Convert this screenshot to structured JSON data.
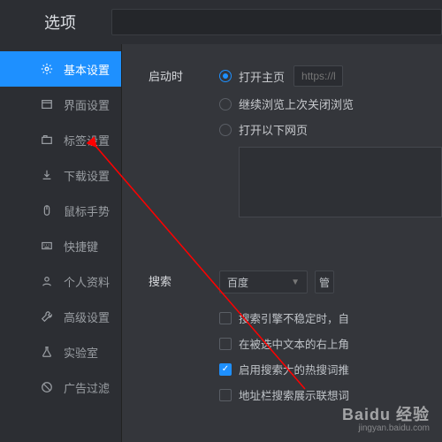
{
  "header": {
    "title": "选项"
  },
  "sidebar": {
    "items": [
      {
        "label": "基本设置",
        "active": true,
        "icon": "gear"
      },
      {
        "label": "界面设置",
        "active": false,
        "icon": "window"
      },
      {
        "label": "标签设置",
        "active": false,
        "icon": "tabs"
      },
      {
        "label": "下载设置",
        "active": false,
        "icon": "download"
      },
      {
        "label": "鼠标手势",
        "active": false,
        "icon": "mouse"
      },
      {
        "label": "快捷键",
        "active": false,
        "icon": "keyboard"
      },
      {
        "label": "个人资料",
        "active": false,
        "icon": "profile"
      },
      {
        "label": "高级设置",
        "active": false,
        "icon": "wrench"
      },
      {
        "label": "实验室",
        "active": false,
        "icon": "flask"
      },
      {
        "label": "广告过滤",
        "active": false,
        "icon": "block"
      }
    ]
  },
  "startup": {
    "label": "启动时",
    "opts": [
      {
        "text": "打开主页",
        "checked": true
      },
      {
        "text": "继续浏览上次关闭浏览",
        "checked": false
      },
      {
        "text": "打开以下网页",
        "checked": false
      }
    ],
    "homepage_placeholder": "https://h"
  },
  "search": {
    "label": "搜索",
    "engine": "百度",
    "manage_btn": "管",
    "checks": [
      {
        "text": "搜索引擎不稳定时，自",
        "checked": false
      },
      {
        "text": "在被选中文本的右上角",
        "checked": false
      },
      {
        "text": "启用搜索大的热搜词推",
        "checked": true
      },
      {
        "text": "地址栏搜索展示联想词",
        "checked": false
      }
    ]
  },
  "watermark": {
    "logo": "Baidu 经验",
    "sub": "jingyan.baidu.com"
  }
}
